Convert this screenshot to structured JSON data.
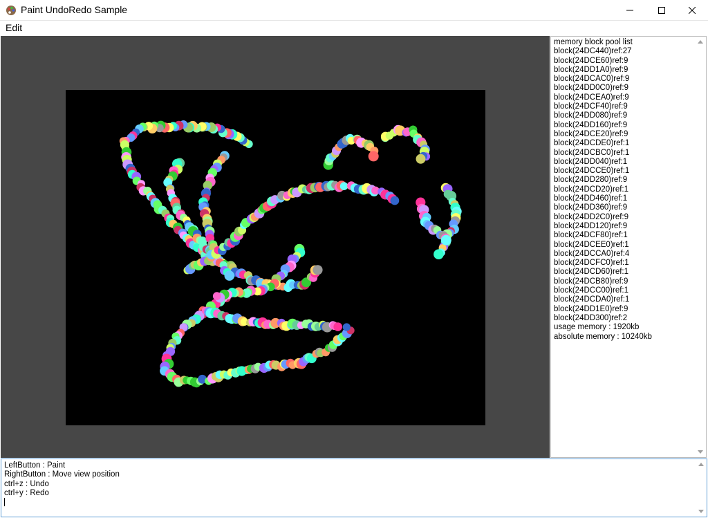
{
  "window": {
    "title": "Paint UndoRedo Sample",
    "icon": "paint-palette-icon"
  },
  "menu": {
    "items": [
      {
        "label": "Edit"
      }
    ]
  },
  "pool_panel": {
    "lines": [
      "memory block pool list",
      "block(24DC440)ref:27",
      "block(24DCE60)ref:9",
      "block(24DD1A0)ref:9",
      "block(24DCAC0)ref:9",
      "block(24DD0C0)ref:9",
      "block(24DCEA0)ref:9",
      "block(24DCF40)ref:9",
      "block(24DD080)ref:9",
      "block(24DD160)ref:9",
      "block(24DCE20)ref:9",
      "block(24DCDE0)ref:1",
      "block(24DCBC0)ref:1",
      "block(24DD040)ref:1",
      "block(24DCCE0)ref:1",
      "block(24DD280)ref:9",
      "block(24DCD20)ref:1",
      "block(24DD460)ref:1",
      "block(24DD360)ref:9",
      "block(24DD2C0)ref:9",
      "block(24DD120)ref:9",
      "block(24DCF80)ref:1",
      "block(24DCEE0)ref:1",
      "block(24DCCA0)ref:4",
      "block(24DCFC0)ref:1",
      "block(24DCD60)ref:1",
      "block(24DCB80)ref:9",
      "block(24DCC00)ref:1",
      "block(24DCDA0)ref:1",
      "block(24DD1E0)ref:9",
      "block(24DD300)ref:2",
      "usage memory : 1920kb",
      "absolute memory : 10240kb"
    ]
  },
  "help_panel": {
    "lines": [
      "LeftButton : Paint",
      "RightButton : Move view position",
      "ctrl+z : Undo",
      "ctrl+y : Redo"
    ]
  },
  "colors": {
    "canvas_bg": "#000000",
    "view_bg": "#474747",
    "help_border": "#5b9bd5"
  }
}
